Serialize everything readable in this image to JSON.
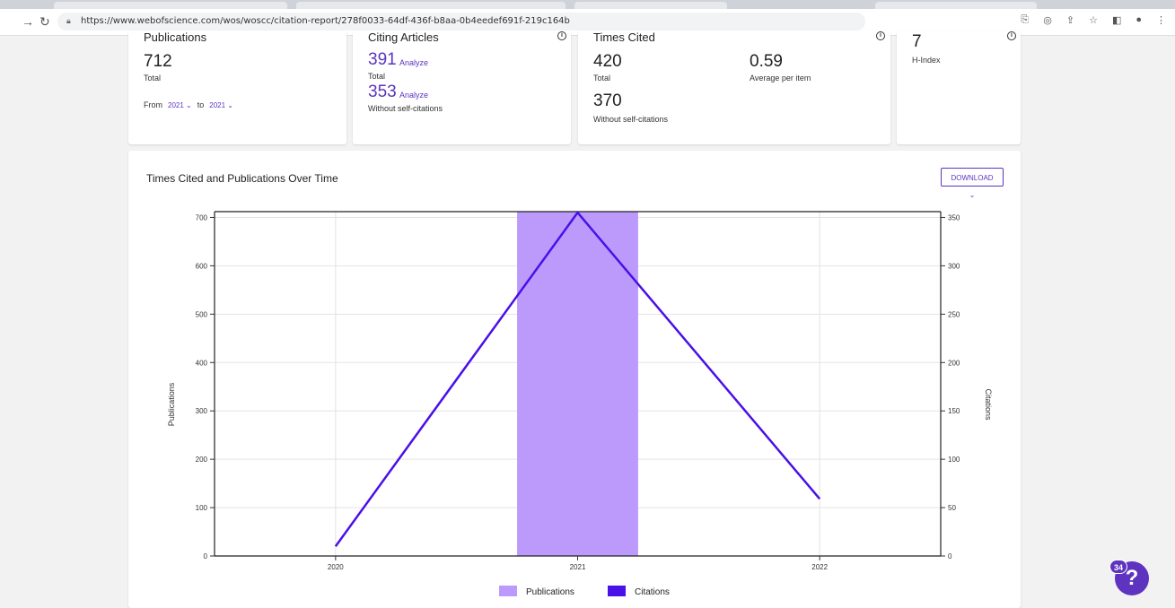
{
  "browser": {
    "url": "https://www.webofscience.com/wos/woscc/citation-report/278f0033-64df-436f-b8aa-0b4eedef691f-219c164b"
  },
  "publications_card": {
    "title": "Publications",
    "total_value": "712",
    "total_label": "Total",
    "from_label": "From",
    "from_value": "2021",
    "to_label": "to",
    "to_value": "2021"
  },
  "citing_card": {
    "title": "Citing Articles",
    "total_value": "391",
    "analyze_label": "Analyze",
    "total_label": "Total",
    "without_value": "353",
    "analyze_label_2": "Analyze",
    "without_label": "Without self-citations"
  },
  "times_cited_card": {
    "title": "Times Cited",
    "total_value": "420",
    "total_label": "Total",
    "avg_value": "0.59",
    "avg_label": "Average per item",
    "without_value": "370",
    "without_label": "Without self-citations"
  },
  "hindex_card": {
    "value": "7",
    "label": "H-Index"
  },
  "chart_card": {
    "title": "Times Cited and Publications Over Time",
    "download_label": "DOWNLOAD ⌄"
  },
  "chart_data": {
    "type": "bar",
    "title": "Times Cited and Publications Over Time",
    "categories": [
      "2020",
      "2021",
      "2022"
    ],
    "series": [
      {
        "name": "Publications",
        "type": "bar",
        "axis": "left",
        "values": [
          0,
          712,
          0
        ],
        "color": "#bb9afc"
      },
      {
        "name": "Citations",
        "type": "line",
        "axis": "right",
        "values": [
          10,
          355,
          59
        ],
        "color": "#4a10e8"
      }
    ],
    "ylabel": "Publications",
    "y2label": "Citations",
    "ylim": [
      0,
      712
    ],
    "y2lim": [
      0,
      356
    ],
    "yticks": [
      "0",
      "100",
      "200",
      "300",
      "400",
      "500",
      "600",
      "700"
    ],
    "y2ticks": [
      "0",
      "50",
      "100",
      "150",
      "200",
      "250",
      "300",
      "350"
    ],
    "legend": "bottom",
    "grid": true
  },
  "help": {
    "badge": "34",
    "symbol": "?"
  },
  "colors": {
    "accent": "#5e33bf",
    "bar": "#bb9afc",
    "line": "#4a10e8"
  }
}
